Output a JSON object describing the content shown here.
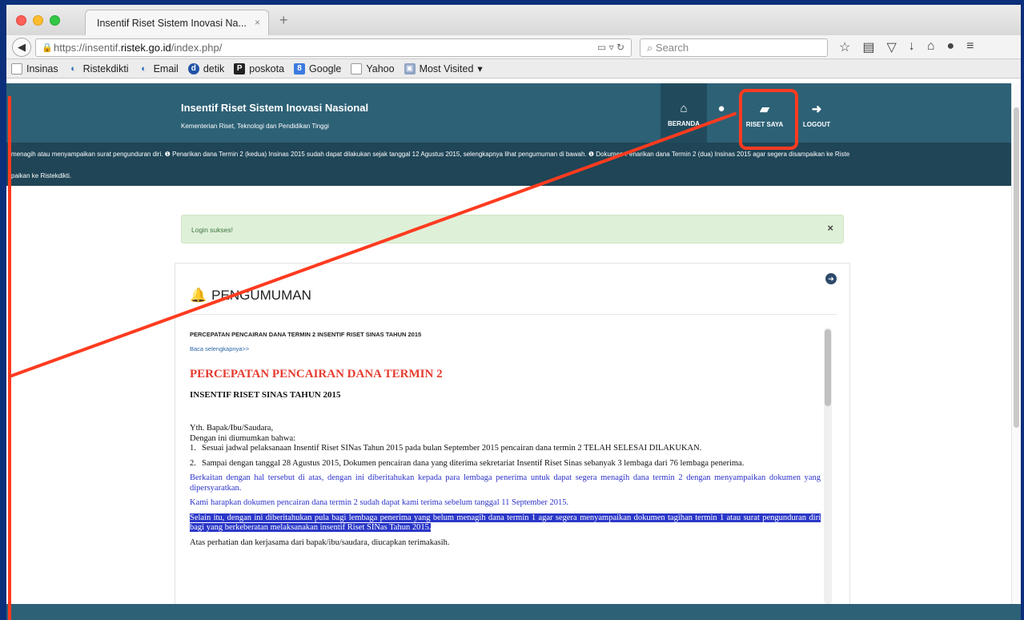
{
  "browser": {
    "tab_title": "Insentif Riset Sistem Inovasi Na...",
    "tab_close": "×",
    "new_tab": "+",
    "url_prefix": "https://insentif.",
    "url_domain": "ristek.go.id",
    "url_suffix": "/index.php/",
    "search_placeholder": "Search",
    "bookmarks": [
      {
        "label": "Insinas",
        "icon": "blank-page-icon"
      },
      {
        "label": "Ristekdikti",
        "icon": "ristek-icon"
      },
      {
        "label": "Email",
        "icon": "ristek-icon"
      },
      {
        "label": "detik",
        "icon": "detik-icon"
      },
      {
        "label": "poskota",
        "icon": "poskota-icon"
      },
      {
        "label": "Google",
        "icon": "google-icon"
      },
      {
        "label": "Yahoo",
        "icon": "blank-page-icon"
      },
      {
        "label": "Most Visited",
        "icon": "folder-icon"
      }
    ]
  },
  "header": {
    "title": "Insentif Riset Sistem Inovasi Nasional",
    "subtitle": "Kementerian Riset, Teknologi dan Pendidikan Tinggi",
    "nav": {
      "beranda": "BERANDA",
      "riset_saya": "RISET SAYA",
      "logout": "LOGOUT"
    }
  },
  "ticker": {
    "line1": "menagih atau menyampaikan surat pengunduran diri.    ❶ Penarikan dana Termin 2 (kedua) Insinas 2015 sudah dapat dilakukan sejak tanggal 12 Agustus 2015, selengkapnya lihat pengumuman di bawah.    ❶ Dokumen Penarikan dana Termin 2 (dua) Insinas 2015 agar segera disampaikan ke Riste",
    "line2": "paikan ke Ristekdikti."
  },
  "alert": {
    "message": "Login sukses!",
    "close": "×"
  },
  "announcement": {
    "heading": "PENGUMUMAN",
    "item_title": "PERCEPATAN PENCAIRAN DANA TERMIN 2 INSENTIF RISET SINAS TAHUN 2015",
    "read_more": "Baca selengkapnya>>",
    "big_title": "PERCEPATAN PENCAIRAN DANA TERMIN 2",
    "big_subtitle": "INSENTIF RISET SINAS TAHUN 2015",
    "greeting": "Yth. Bapak/Ibu/Saudara,",
    "intro": "Dengan ini diumumkan bahwa:",
    "items": [
      {
        "n": "1.",
        "text": "Sesuai jadwal pelaksanaan Insentif Riset SINas Tahun 2015 pada bulan September 2015 pencairan dana termin 2 TELAH SELESAI DILAKUKAN."
      },
      {
        "n": "2.",
        "text": "Sampai dengan tanggal 28 Agustus 2015, Dokumen pencairan dana yang diterima sekretariat Insentif Riset Sinas sebanyak 3 lembaga dari 76 lembaga penerima."
      }
    ],
    "para_blue1": "Berkaitan dengan hal tersebut di atas, dengan ini diberitahukan kepada para lembaga penerima untuk dapat segera menagih dana termin 2 dengan menyampaikan dokumen yang dipersyaratkan.",
    "para_blue2": "Kami harapkan dokumen pencairan dana termin 2 sudah dapat kami terima sebelum tanggal 11 September 2015.",
    "para_highlight": "Selain itu, dengan ini diberitahukan pula bagi lembaga penerima yang belum menagih dana termin 1 agar segera menyampaikan dokumen tagihan termin 1 atau surat pengunduran diri bagi yang berkeberatan melaksanakan insentif Riset SINas Tahun 2015.",
    "closing": "Atas perhatian dan kerjasama dari bapak/ibu/saudara, diucapkan terimakasih."
  },
  "colors": {
    "header_bg": "#2d6176",
    "ticker_bg": "#1f4556",
    "annotation_red": "#ff3b1f",
    "alert_bg": "#dff0d8",
    "title_red": "#e53b2f",
    "text_blue": "#2b32c8"
  }
}
